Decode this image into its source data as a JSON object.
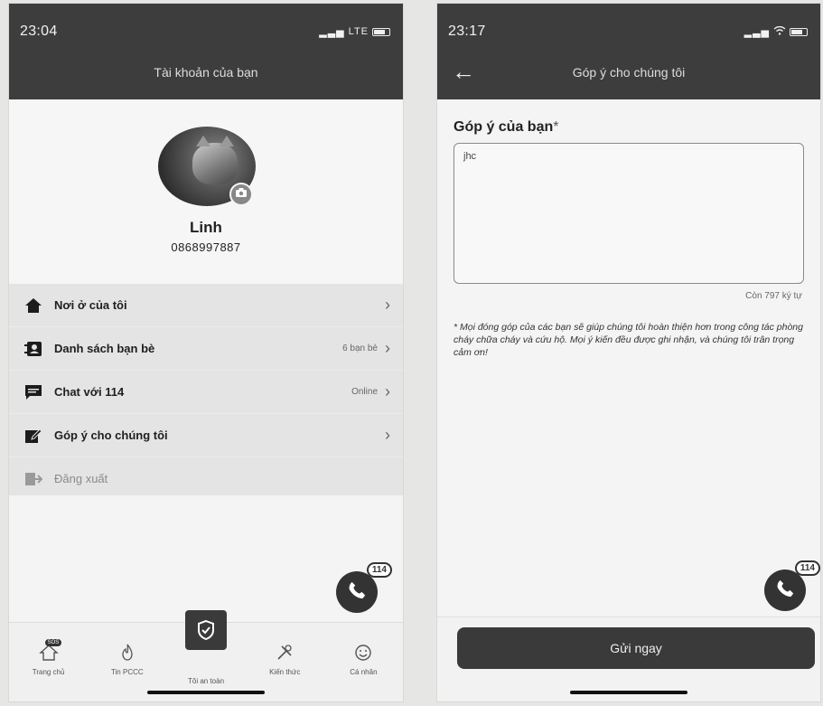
{
  "left": {
    "status": {
      "time": "23:04",
      "network": "LTE"
    },
    "header_title": "Tài khoản của bạn",
    "profile": {
      "name": "Linh",
      "phone": "0868997887"
    },
    "menu": [
      {
        "label": "Nơi ở của tôi",
        "meta": "",
        "icon": "home-icon"
      },
      {
        "label": "Danh sách bạn bè",
        "meta": "6 bạn bè",
        "icon": "contacts-icon"
      },
      {
        "label": "Chat với 114",
        "meta": "Online",
        "icon": "chat-icon"
      },
      {
        "label": "Góp ý cho chúng tôi",
        "meta": "",
        "icon": "edit-icon"
      },
      {
        "label": "Đăng xuất",
        "meta": "",
        "icon": "logout-icon"
      }
    ],
    "fab_badge": "114",
    "tabs": [
      {
        "label": "Trang chủ",
        "badge": "SOS"
      },
      {
        "label": "Tin PCCC"
      },
      {
        "label": "Tôi an toàn"
      },
      {
        "label": "Kiến thức"
      },
      {
        "label": "Cá nhân"
      }
    ]
  },
  "right": {
    "status": {
      "time": "23:17"
    },
    "header_title": "Góp ý cho chúng tôi",
    "field_label": "Góp ý của bạn",
    "field_required": "*",
    "textarea_value": "jhc",
    "char_count": "Còn 797 ký tự",
    "note": "* Mọi đóng góp của các bạn sẽ giúp chúng tôi hoàn thiện hơn trong công tác phòng cháy chữa cháy và cứu hộ. Mọi ý kiến đều được ghi nhận, và chúng tôi trân trọng cảm ơn!",
    "fab_badge": "114",
    "submit_label": "Gửi ngay"
  }
}
